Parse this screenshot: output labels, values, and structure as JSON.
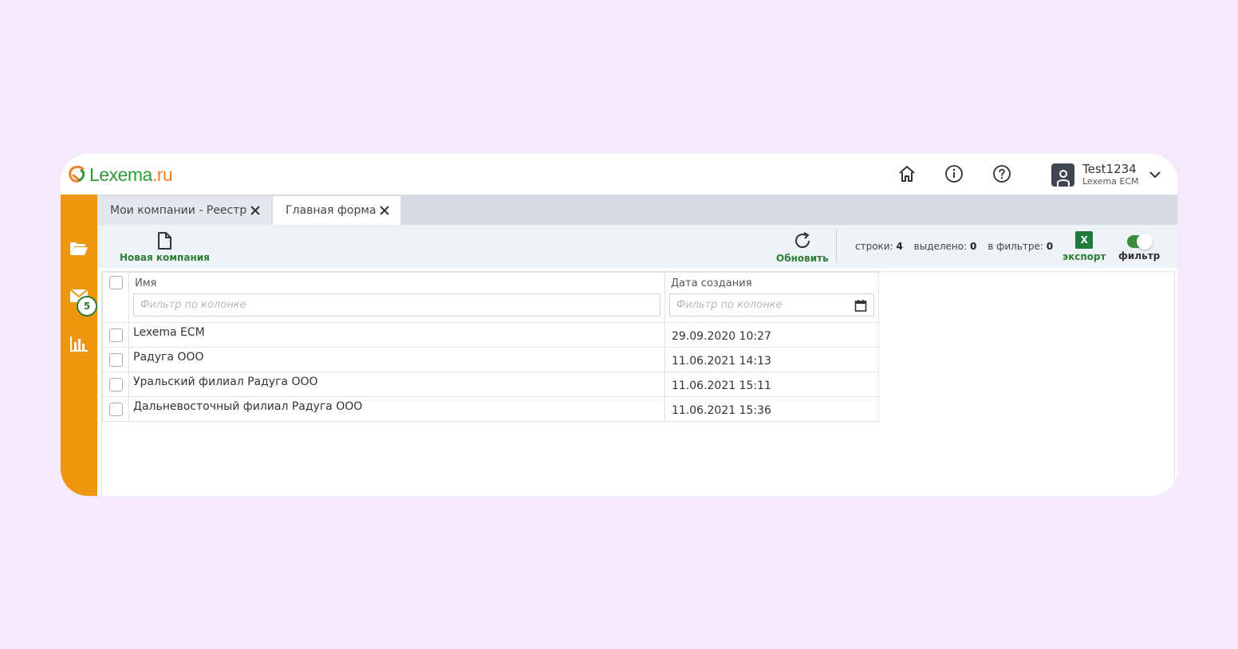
{
  "app": {
    "logo_text_main": "Lexema",
    "logo_text_tld": ".ru"
  },
  "header": {
    "user_name": "Test1234",
    "user_sub": "Lexema ECM"
  },
  "sidebar": {
    "mail_badge": "5"
  },
  "tabs": [
    {
      "label": "Мои компании - Реестр"
    },
    {
      "label": "Главная форма"
    }
  ],
  "toolbar": {
    "new_label": "Новая компания",
    "refresh_label": "Обновить",
    "rows_label": "строки:",
    "rows_value": "4",
    "selected_label": "выделено:",
    "selected_value": "0",
    "filtered_label": "в фильтре:",
    "filtered_value": "0",
    "export_label": "экспорт",
    "export_icon_text": "X",
    "filter_label": "фильтр",
    "filter_on": true
  },
  "grid": {
    "columns": [
      {
        "label": "Имя",
        "filter_placeholder": "Фильтр по колонке"
      },
      {
        "label": "Дата создания",
        "filter_placeholder": "Фильтр по колонке"
      }
    ],
    "rows": [
      {
        "name": "Lexema ECM",
        "date": "29.09.2020 10:27"
      },
      {
        "name": "Радуга ООО",
        "date": "11.06.2021 14:13"
      },
      {
        "name": "Уральский филиал Радуга ООО",
        "date": "11.06.2021 15:11"
      },
      {
        "name": "Дальневосточный филиал Радуга ООО",
        "date": "11.06.2021 15:36"
      }
    ]
  },
  "colors": {
    "sidebar": "#f0950e",
    "accent_green": "#2e7d35",
    "page_bg": "#f4eafc"
  }
}
